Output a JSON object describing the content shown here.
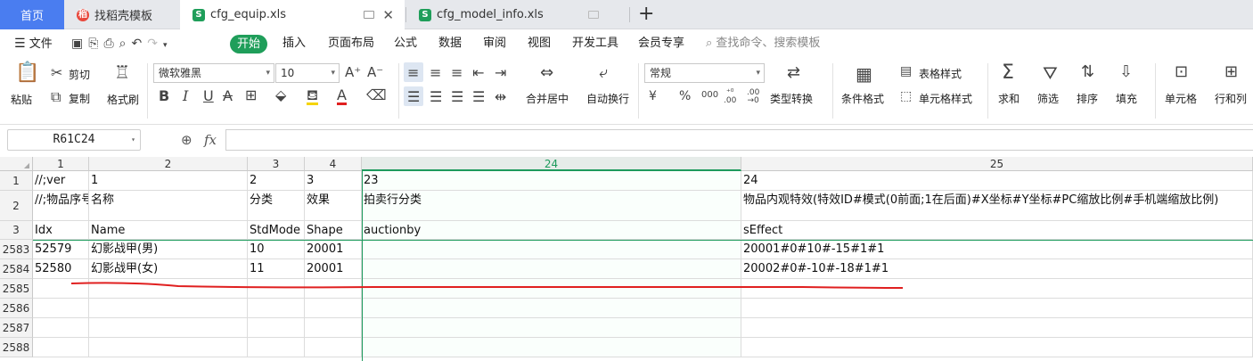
{
  "tabs": {
    "home": "首页",
    "template": "找稻壳模板",
    "equip": "cfg_equip.xls",
    "model": "cfg_model_info.xls",
    "add": "+"
  },
  "menu": {
    "file": "文件",
    "items": [
      "开始",
      "插入",
      "页面布局",
      "公式",
      "数据",
      "审阅",
      "视图",
      "开发工具",
      "会员专享"
    ],
    "search": "查找命令、搜索模板"
  },
  "ribbon": {
    "paste": "粘贴",
    "cut": "剪切",
    "copy": "复制",
    "format_painter": "格式刷",
    "font_name": "微软雅黑",
    "font_size": "10",
    "merge": "合并居中",
    "wrap": "自动换行",
    "number_format": "常规",
    "type_convert": "类型转换",
    "conditional": "条件格式",
    "table_style": "表格样式",
    "cell_style": "单元格样式",
    "sum": "求和",
    "filter": "筛选",
    "sort": "排序",
    "fill": "填充",
    "cell": "单元格",
    "rowcol": "行和列"
  },
  "formula_bar": {
    "name_box": "R61C24",
    "fx": "fx"
  },
  "sheet": {
    "columns": [
      "1",
      "2",
      "3",
      "4",
      "24",
      "25"
    ],
    "selected_column": "24",
    "rows": [
      {
        "num": "1",
        "cells": [
          "//;ver",
          "1",
          "2",
          "3",
          "23",
          "24"
        ]
      },
      {
        "num": "2",
        "cells": [
          "//;物品序号",
          "名称",
          "分类",
          "效果",
          "拍卖行分类",
          "物品内观特效(特效ID#模式(0前面;1在后面)#X坐标#Y坐标#PC缩放比例#手机端缩放比例)"
        ]
      },
      {
        "num": "3",
        "cells": [
          "Idx",
          "Name",
          "StdMode",
          "Shape",
          "auctionby",
          "sEffect"
        ]
      },
      {
        "num": "2583",
        "cells": [
          "52579",
          "幻影战甲(男)",
          "10",
          "20001",
          "",
          "20001#0#10#-15#1#1"
        ]
      },
      {
        "num": "2584",
        "cells": [
          "52580",
          "幻影战甲(女)",
          "11",
          "20001",
          "",
          "20002#0#-10#-18#1#1"
        ]
      },
      {
        "num": "2585",
        "cells": [
          "",
          "",
          "",
          "",
          "",
          ""
        ]
      },
      {
        "num": "2586",
        "cells": [
          "",
          "",
          "",
          "",
          "",
          ""
        ]
      },
      {
        "num": "2587",
        "cells": [
          "",
          "",
          "",
          "",
          "",
          ""
        ]
      },
      {
        "num": "2588",
        "cells": [
          "",
          "",
          "",
          "",
          "",
          ""
        ]
      }
    ]
  },
  "colors": {
    "accent_green": "#1d9a5c",
    "tab_home_blue": "#4a7df0",
    "annotation_red": "#e02020"
  }
}
